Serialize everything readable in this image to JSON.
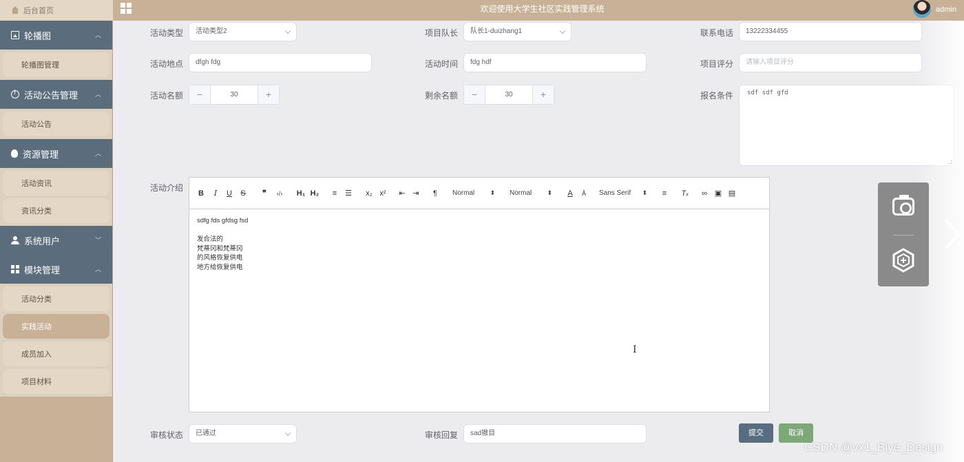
{
  "header": {
    "home_tab": "后台首页",
    "title": "欢迎使用大学生社区实践管理系统",
    "user": "admin"
  },
  "sidebar": {
    "groups": [
      {
        "label": "轮播图",
        "icon": "image-icon",
        "items": [
          "轮播图管理"
        ]
      },
      {
        "label": "活动公告管理",
        "icon": "info-circle-icon",
        "items": [
          "活动公告"
        ]
      },
      {
        "label": "资源管理",
        "icon": "lightbulb-icon",
        "items": [
          "活动资讯",
          "资讯分类"
        ]
      },
      {
        "label": "系统用户",
        "icon": "user-icon",
        "items": []
      },
      {
        "label": "模块管理",
        "icon": "grid-icon",
        "items": [
          "活动分类",
          "实践活动",
          "成员加入",
          "项目材料"
        ]
      }
    ],
    "active_item": "实践活动"
  },
  "form": {
    "activity_type": {
      "label": "活动类型",
      "value": "活动类型2"
    },
    "project_leader": {
      "label": "项目队长",
      "value": "队长1-duizhang1"
    },
    "phone": {
      "label": "联系电话",
      "value": "13222334455"
    },
    "location": {
      "label": "活动地点",
      "value": "dfgh fdg"
    },
    "activity_time": {
      "label": "活动时间",
      "value": "fdg hdf"
    },
    "project_rating": {
      "label": "项目评分",
      "placeholder": "请输入项目评分",
      "value": ""
    },
    "quota": {
      "label": "活动名额",
      "value": "30"
    },
    "remaining_quota": {
      "label": "剩余名额",
      "value": "30"
    },
    "requirements": {
      "label": "报名条件",
      "value": "sdf sdf gfd"
    },
    "intro": {
      "label": "活动介绍",
      "content": [
        "sdfg fds gfdsg fsd",
        "",
        "发合法的",
        "梵蒂冈和梵蒂冈",
        "的风格恢复供电",
        "地方给恢复供电"
      ]
    },
    "review_status": {
      "label": "审核状态",
      "value": "已通过"
    },
    "review_reply": {
      "label": "审核回复",
      "value": "sad撤目"
    },
    "submit_label": "提交",
    "cancel_label": "取消"
  },
  "editor_toolbar": {
    "header_select": "Normal",
    "size_select": "Normal",
    "font_select": "Sans Serif"
  },
  "watermark": "CSDN @vx1_Biye_Design",
  "colors": {
    "topbar": "#c8b196",
    "sidebar_group": "#5b6d7d",
    "sidebar_item": "#e4d7c5",
    "submit": "#596d80",
    "cancel": "#7ea87a"
  }
}
